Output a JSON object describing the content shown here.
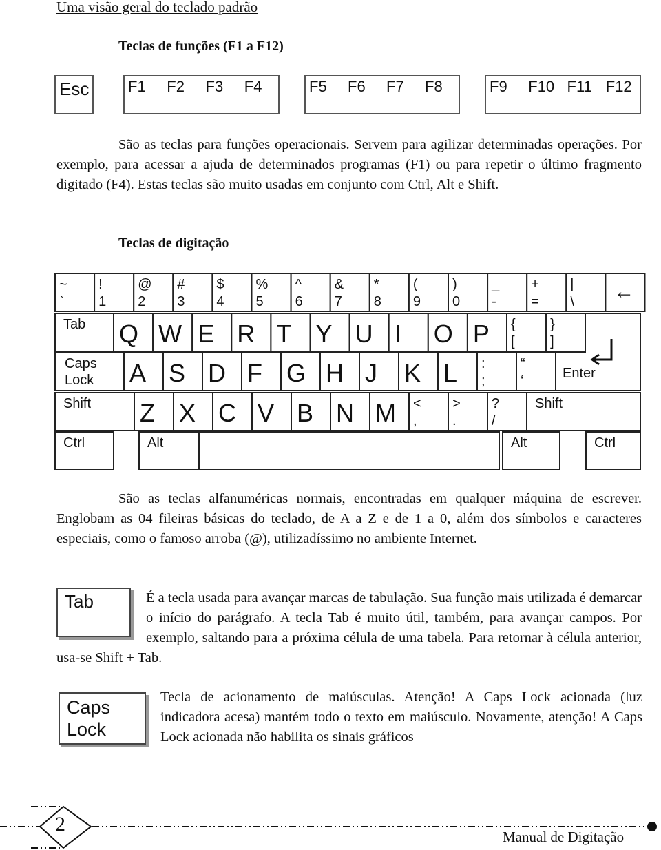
{
  "page_title": "Uma visão geral do teclado padrão",
  "section1": {
    "heading": "Teclas de funções (F1 a F12)",
    "keys": [
      [
        "Esc"
      ],
      [
        "F1",
        "F2",
        "F3",
        "F4"
      ],
      [
        "F5",
        "F6",
        "F7",
        "F8"
      ],
      [
        "F9",
        "F10",
        "F11",
        "F12"
      ]
    ],
    "paragraph": "São as teclas para funções operacionais. Servem para agilizar determinadas operações. Por exemplo, para acessar a ajuda de determinados programas (F1) ou para repetir o último fragmento digitado (F4). Estas teclas são muito usadas em conjunto com Ctrl, Alt e Shift."
  },
  "section2": {
    "heading": "Teclas de digitação",
    "rows": [
      [
        [
          "~",
          "`"
        ],
        [
          "!",
          "1"
        ],
        [
          "@",
          "2"
        ],
        [
          "#",
          "3"
        ],
        [
          "$",
          "4"
        ],
        [
          "%",
          "5"
        ],
        [
          "^",
          "6"
        ],
        [
          "&",
          "7"
        ],
        [
          "*",
          "8"
        ],
        [
          "(",
          "9"
        ],
        [
          ")",
          "0"
        ],
        [
          "_",
          "-"
        ],
        [
          "+",
          "="
        ],
        [
          "|",
          "\\"
        ],
        [
          "←",
          ""
        ]
      ],
      [
        [
          "Tab"
        ],
        [
          "Q"
        ],
        [
          "W"
        ],
        [
          "E"
        ],
        [
          "R"
        ],
        [
          "T"
        ],
        [
          "Y"
        ],
        [
          "U"
        ],
        [
          "I"
        ],
        [
          "O"
        ],
        [
          "P"
        ],
        [
          "{",
          "["
        ],
        [
          "}",
          "]"
        ]
      ],
      [
        [
          "Caps Lock"
        ],
        [
          "A"
        ],
        [
          "S"
        ],
        [
          "D"
        ],
        [
          "F"
        ],
        [
          "G"
        ],
        [
          "H"
        ],
        [
          "J"
        ],
        [
          "K"
        ],
        [
          "L"
        ],
        [
          ":",
          ";"
        ],
        [
          "“",
          "‘"
        ],
        [
          "Enter"
        ]
      ],
      [
        [
          "Shift"
        ],
        [
          "Z"
        ],
        [
          "X"
        ],
        [
          "C"
        ],
        [
          "V"
        ],
        [
          "B"
        ],
        [
          "N"
        ],
        [
          "M"
        ],
        [
          "<",
          ","
        ],
        [
          ">",
          "."
        ],
        [
          "?",
          "/"
        ],
        [
          "Shift"
        ]
      ],
      [
        [
          "Ctrl"
        ],
        [
          "Alt"
        ],
        [
          ""
        ],
        [
          "Alt"
        ],
        [
          "Ctrl"
        ]
      ]
    ],
    "paragraph": "São as teclas alfanuméricas normais, encontradas em qualquer máquina de escrever. Englobam as 04 fileiras básicas do teclado, de A a Z e de 1 a 0, além dos símbolos e caracteres especiais, como o famoso arroba (@), utilizadíssimo no ambiente Internet."
  },
  "tab": {
    "key_label": "Tab",
    "paragraph": "É a tecla usada para avançar marcas de tabulação. Sua função mais utilizada é demarcar o início do parágrafo. A tecla Tab é muito útil, também, para avançar campos. Por exemplo, saltando para a próxima célula de uma tabela. Para retornar à célula anterior, usa-se Shift + Tab."
  },
  "caps": {
    "key_line1": "Caps",
    "key_line2": "Lock",
    "paragraph": "Tecla de acionamento de maiúsculas. Atenção! A Caps Lock acionada (luz indicadora acesa) mantém todo o texto em maiúsculo. Novamente, atenção! A Caps Lock acionada não habilita os sinais gráficos"
  },
  "footer": {
    "page_number": "2",
    "book_title": "Manual de Digitação"
  }
}
